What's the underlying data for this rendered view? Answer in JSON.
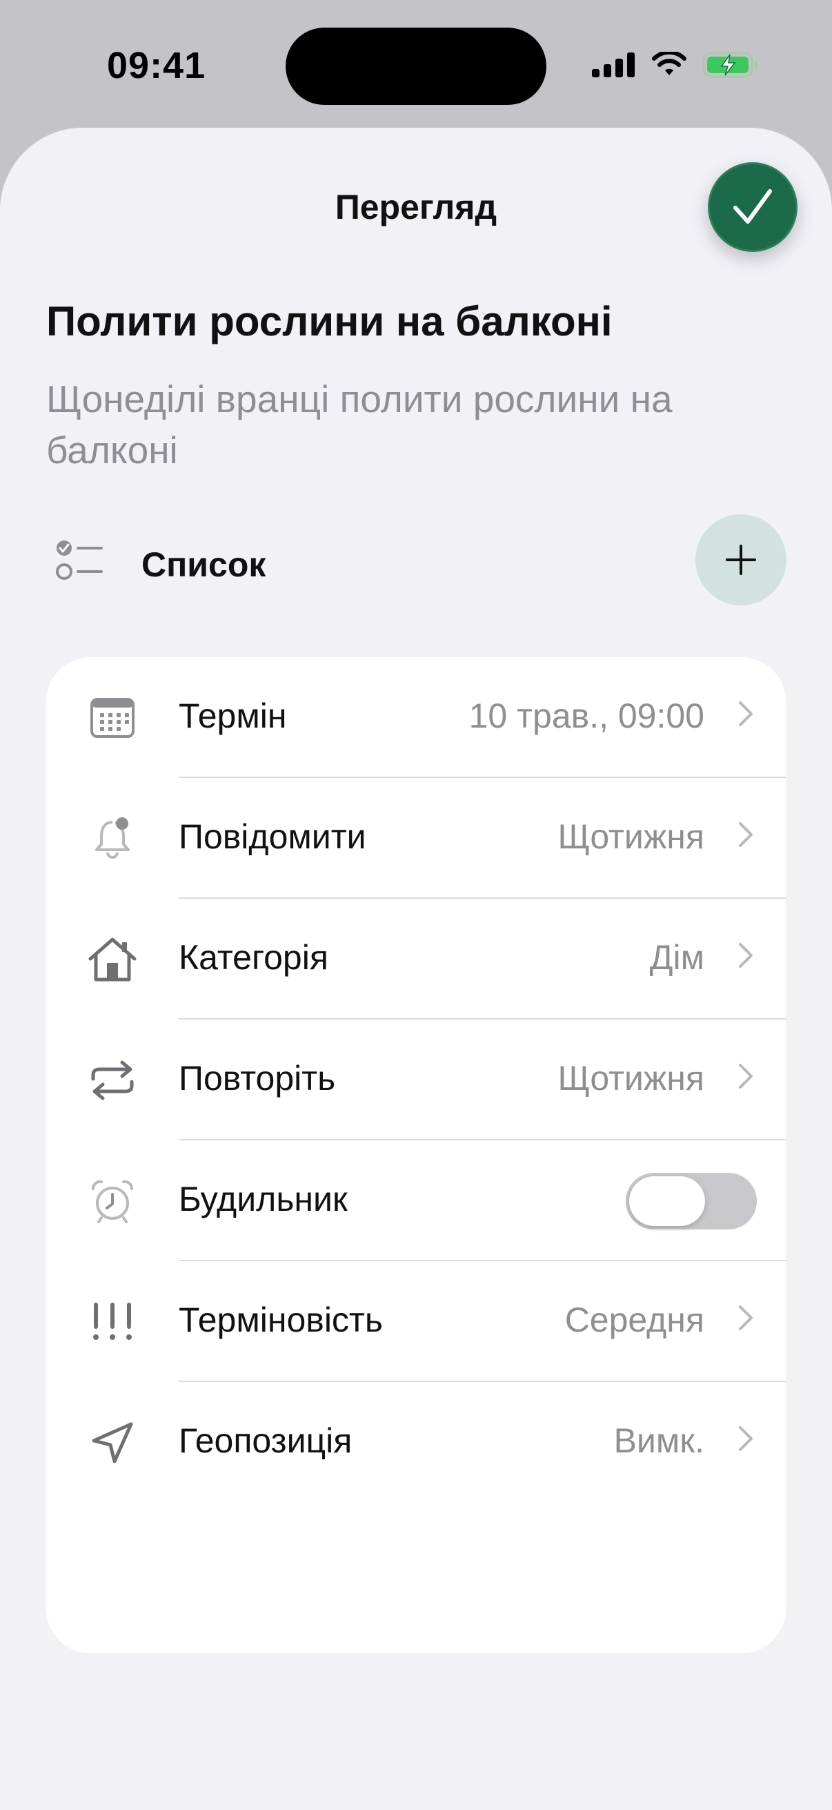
{
  "status_bar": {
    "time": "09:41"
  },
  "sheet": {
    "title": "Перегляд",
    "done_icon": "checkmark-icon",
    "accent_color": "#1b6b4a"
  },
  "task": {
    "title": "Полити рослини на балконі",
    "description": "Щонеділі вранці полити рослини на балконі"
  },
  "list": {
    "label": "Список",
    "add_icon": "plus-icon"
  },
  "details": {
    "rows": [
      {
        "icon": "calendar-icon",
        "label": "Термін",
        "value": "10 трав., 09:00"
      },
      {
        "icon": "bell-icon",
        "label": "Повідомити",
        "value": "Щотижня"
      },
      {
        "icon": "house-icon",
        "label": "Категорія",
        "value": "Дім"
      },
      {
        "icon": "repeat-icon",
        "label": "Повторіть",
        "value": "Щотижня"
      },
      {
        "icon": "alarm-icon",
        "label": "Будильник",
        "toggle_on": false
      },
      {
        "icon": "priority-icon",
        "label": "Терміновість",
        "value": "Середня"
      },
      {
        "icon": "location-arrow-icon",
        "label": "Геопозиція",
        "value": "Вимк."
      }
    ]
  }
}
